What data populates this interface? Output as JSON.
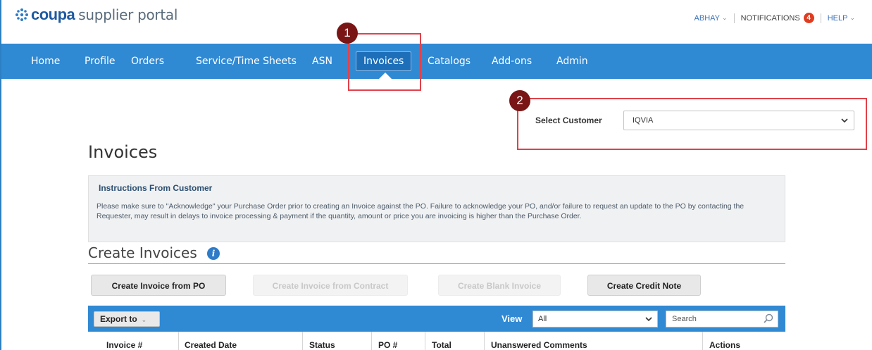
{
  "header": {
    "logo_brand": "coupa",
    "logo_rest": "supplier portal",
    "user": "ABHAY",
    "notifications_label": "NOTIFICATIONS",
    "notifications_count": "4",
    "help": "HELP"
  },
  "nav": {
    "items": [
      "Home",
      "Profile",
      "Orders",
      "Service/Time Sheets",
      "ASN",
      "Invoices",
      "Catalogs",
      "Add-ons",
      "Admin"
    ],
    "active": "Invoices"
  },
  "callouts": [
    "1",
    "2"
  ],
  "customer": {
    "label": "Select Customer",
    "value": "IQVIA"
  },
  "page_title": "Invoices",
  "instructions": {
    "title": "Instructions From Customer",
    "text": "Please make sure to \"Acknowledge\" your Purchase Order prior to creating an Invoice against the PO. Failure to acknowledge your PO, and/or failure to request an update to the PO by contacting the Requester, may result in delays to invoice processing & payment if the quantity, amount or price you are invoicing is higher than the Purchase Order."
  },
  "create": {
    "title": "Create Invoices",
    "buttons": {
      "from_po": "Create Invoice from PO",
      "from_contract": "Create Invoice from Contract",
      "blank": "Create Blank Invoice",
      "credit_note": "Create Credit Note"
    }
  },
  "table": {
    "export_label": "Export to",
    "view_label": "View",
    "view_value": "All",
    "search_placeholder": "Search",
    "columns": [
      "Invoice #",
      "Created Date",
      "Status",
      "PO #",
      "Total",
      "Unanswered Comments",
      "Actions"
    ]
  },
  "colors": {
    "nav_bar": "#3089d3",
    "brand": "#1e5aa0",
    "callout_border": "#e0424b",
    "callout_circle": "#7a1515",
    "badge": "#e03c1f"
  }
}
